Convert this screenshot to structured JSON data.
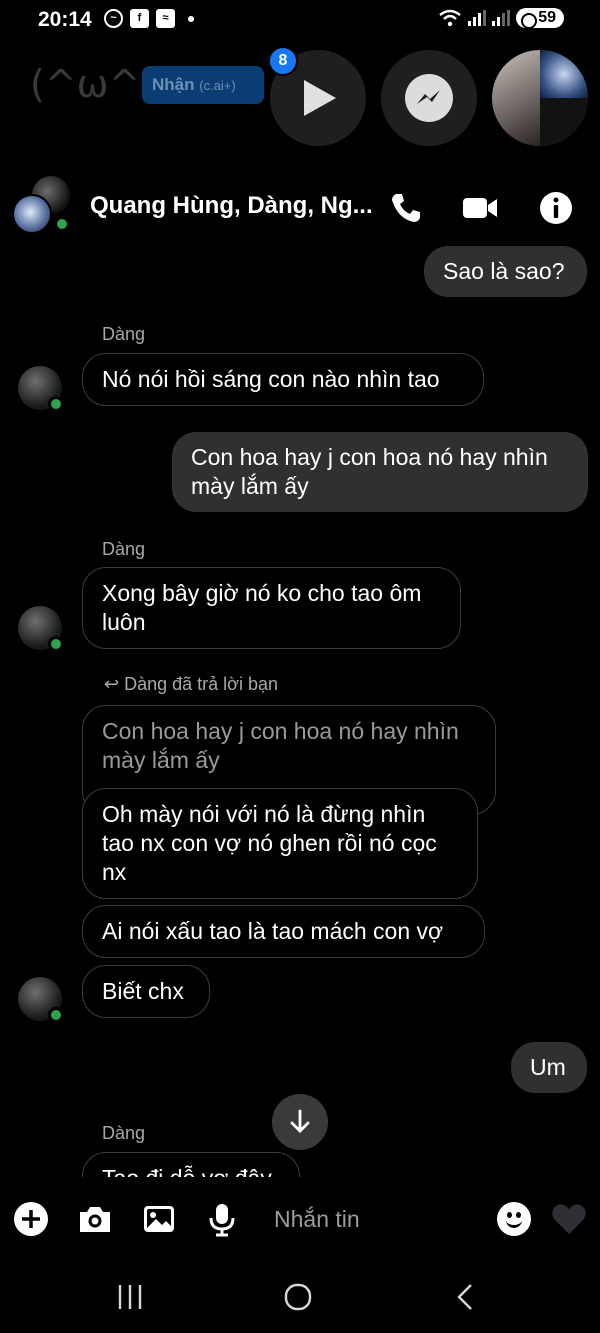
{
  "status_bar": {
    "time": "20:14",
    "battery": "59"
  },
  "background": {
    "kaomoji": "(^ω^)",
    "receive_label": "Nhận",
    "receive_sub": "(c.ai+)",
    "badge_count": "8"
  },
  "header": {
    "title": "Quang Hùng, Dàng, Ng..."
  },
  "messages": [
    {
      "type": "out",
      "text": "Sao là sao?"
    },
    {
      "type": "sender",
      "text": "Dàng"
    },
    {
      "type": "in",
      "text": "Nó nói hồi sáng con nào nhìn tao"
    },
    {
      "type": "out",
      "text": "Con hoa hay j con hoa nó hay nhìn mày lắm ấy"
    },
    {
      "type": "sender",
      "text": "Dàng"
    },
    {
      "type": "in",
      "text": "Xong bây giờ nó ko cho tao ôm luôn"
    },
    {
      "type": "reply_note",
      "text": "Dàng đã trả lời bạn"
    },
    {
      "type": "quoted",
      "text": "Con hoa hay j con hoa nó hay nhìn mày lắm ấy"
    },
    {
      "type": "in",
      "text": "Oh mày nói với nó là đừng nhìn tao nx con vợ nó ghen rồi nó cọc nx"
    },
    {
      "type": "in",
      "text": "Ai nói xấu tao là tao mách con vợ"
    },
    {
      "type": "in",
      "text": "Biết chx"
    },
    {
      "type": "out",
      "text": "Um"
    },
    {
      "type": "sender",
      "text": "Dàng"
    },
    {
      "type": "in",
      "text": "Tao đi dỗ vợ đây"
    }
  ],
  "composer": {
    "placeholder": "Nhắn tin"
  },
  "colors": {
    "online": "#31a24c",
    "badge": "#1877f2",
    "outgoing_bubble": "#303030"
  }
}
